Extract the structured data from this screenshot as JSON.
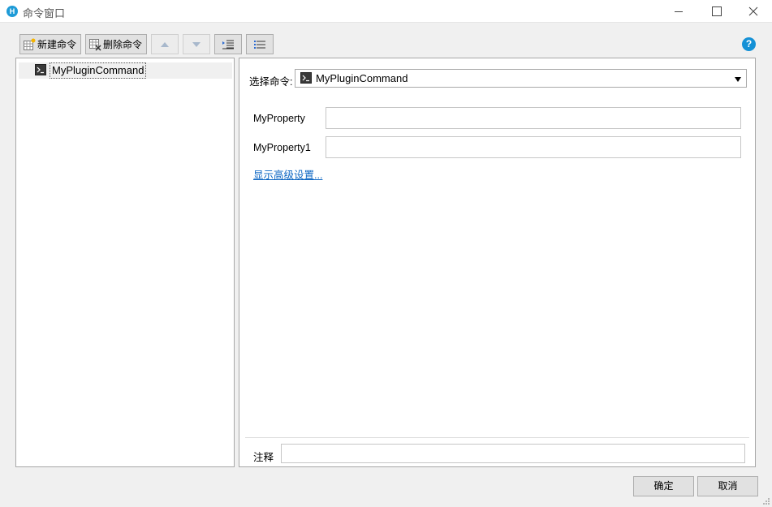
{
  "window": {
    "title": "命令窗口",
    "app_icon_letter": "H"
  },
  "toolbar": {
    "new_label": "新建命令",
    "delete_label": "删除命令",
    "help_label": "?"
  },
  "tree": {
    "items": [
      {
        "label": "MyPluginCommand",
        "icon": "terminal-icon",
        "selected": true
      }
    ]
  },
  "form": {
    "select_label": "选择命令:",
    "select_value": "MyPluginCommand",
    "fields": [
      {
        "label": "MyProperty",
        "value": ""
      },
      {
        "label": "MyProperty1",
        "value": ""
      }
    ],
    "advanced_link": "显示高级设置...",
    "comment_label": "注释",
    "comment_value": ""
  },
  "footer": {
    "ok_label": "确定",
    "cancel_label": "取消"
  }
}
